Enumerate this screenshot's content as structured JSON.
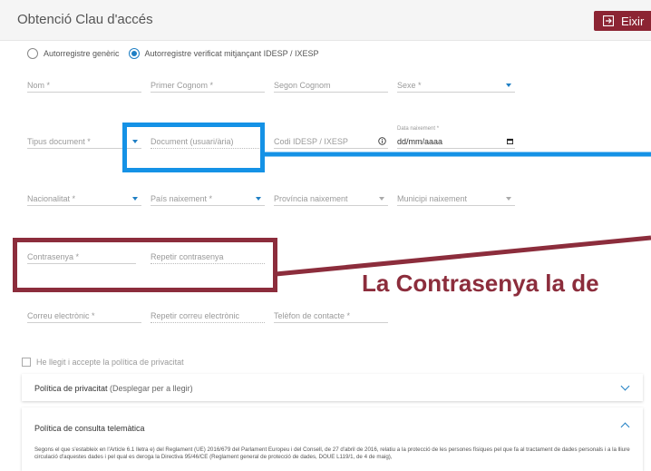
{
  "header": {
    "title": "Obtenció Clau d'accés",
    "exit_label": "Eixir"
  },
  "radios": [
    {
      "label": "Autorregistre genèric",
      "checked": false
    },
    {
      "label": "Autorregistre verificat mitjançant IDESP / IXESP",
      "checked": true
    }
  ],
  "fields": {
    "nom": "Nom *",
    "primer_cognom": "Primer Cognom *",
    "segon_cognom": "Segon Cognom",
    "sexe": "Sexe *",
    "tipus_document": "Tipus document *",
    "document": "Document (usuari/ària)",
    "codi_idesp": "Codi IDESP / IXESP",
    "data_naixement_caption": "Data naixement *",
    "data_naixement_value": "dd/mm/aaaa",
    "nacionalitat": "Nacionalitat *",
    "pais_naixement": "País naixement *",
    "provincia_naixement": "Província naixement",
    "municipi_naixement": "Municipi naixement",
    "contrasenya": "Contrasenya *",
    "repetir_contrasenya": "Repetir contrasenya",
    "correu": "Correu electrònic *",
    "repetir_correu": "Repetir correu electrònic",
    "telefon": "Telèfon de contacte *"
  },
  "callout": {
    "text": "La Contrasenya la de"
  },
  "privacy_checkbox": {
    "label": "He llegit i accepte la política de privacitat"
  },
  "panels": [
    {
      "title": "Política de privacitat",
      "extra": " (Desplegar per a llegir)"
    },
    {
      "title": "Política de consulta telemàtica",
      "text": "Segons el que s'estableix en l'Article 6.1 lletra e) del Reglament (UE) 2016/679 del Parlament Europeu i del Consell, de 27 d'abril de 2016, relatiu a la protecció de les persones físiques pel que fa al tractament de dades personals i a la lliure circulació d'aquestes dades i pel qual es deroga la Directiva 95/46/CE (Reglament general de protecció de dades, DOUE L119/1, de 4 de maig),"
    }
  ],
  "colors": {
    "accent": "#1f7fc4",
    "brand": "#8c2433",
    "highlight_blue": "#1592e6",
    "highlight_red": "#8c2d3c"
  }
}
